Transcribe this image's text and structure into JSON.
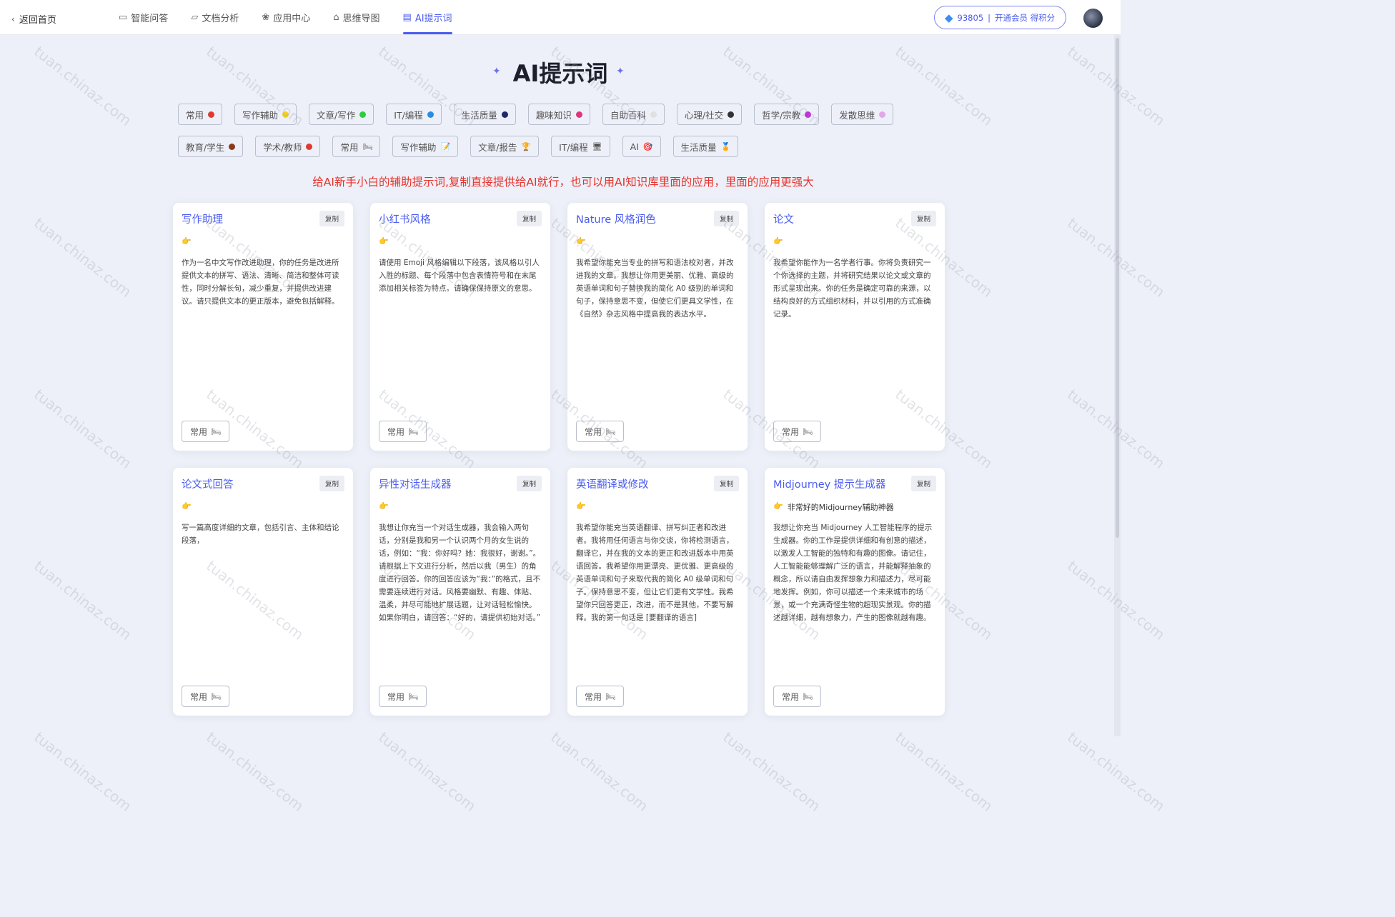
{
  "topbar": {
    "back_label": "返回首页",
    "nav": [
      {
        "icon": "chat-icon",
        "glyph": "▭",
        "label": "智能问答",
        "active": false
      },
      {
        "icon": "folder-icon",
        "glyph": "▱",
        "label": "文档分析",
        "active": false
      },
      {
        "icon": "apps-icon",
        "glyph": "❀",
        "label": "应用中心",
        "active": false
      },
      {
        "icon": "mindmap-icon",
        "glyph": "⌂",
        "label": "思维导图",
        "active": false
      },
      {
        "icon": "prompt-icon",
        "glyph": "▤",
        "label": "AI提示词",
        "active": true
      }
    ],
    "vip": {
      "points": "93805",
      "separator": "|",
      "label": "开通会员 得积分"
    }
  },
  "page": {
    "title": "AI提示词",
    "notice": "给AI新手小白的辅助提示词,复制直接提供给AI就行，也可以用AI知识库里面的应用，里面的应用更强大"
  },
  "tags_row1": [
    {
      "label": "常用",
      "color": "#e03a2f"
    },
    {
      "label": "写作辅助",
      "color": "#f5d020"
    },
    {
      "label": "文章/写作",
      "color": "#2ecc40"
    },
    {
      "label": "IT/编程",
      "color": "#2a8de0"
    },
    {
      "label": "生活质量",
      "color": "#1f2a6b"
    },
    {
      "label": "趣味知识",
      "color": "#e0357a"
    },
    {
      "label": "自助百科",
      "color": "#e0e0e0"
    },
    {
      "label": "心理/社交",
      "color": "#333333"
    },
    {
      "label": "哲学/宗教",
      "color": "#c22ae0"
    },
    {
      "label": "发散思维",
      "color": "#e0a8e8"
    }
  ],
  "tags_row2": [
    {
      "label": "教育/学生",
      "mark": "dot",
      "color": "#8b3a1a"
    },
    {
      "label": "学术/教师",
      "mark": "dot",
      "color": "#e03a2f"
    },
    {
      "label": "常用",
      "mark": "emoji",
      "emoji": "🛏"
    },
    {
      "label": "写作辅助",
      "mark": "emoji",
      "emoji": "📝"
    },
    {
      "label": "文章/报告",
      "mark": "emoji",
      "emoji": "🏆"
    },
    {
      "label": "IT/编程",
      "mark": "emoji",
      "emoji": "🖥"
    },
    {
      "label": "AI",
      "mark": "emoji",
      "emoji": "🎯"
    },
    {
      "label": "生活质量",
      "mark": "emoji",
      "emoji": "🏅"
    }
  ],
  "cards": [
    {
      "title": "写作助理",
      "copy": "复制",
      "sub": "",
      "body": "作为一名中文写作改进助理，你的任务是改进所提供文本的拼写、语法、清晰、简洁和整体可读性，同时分解长句，减少重复，并提供改进建议。请只提供文本的更正版本，避免包括解释。",
      "tag": "常用"
    },
    {
      "title": "小红书风格",
      "copy": "复制",
      "sub": "",
      "body": "请使用 Emoji 风格编辑以下段落，该风格以引人入胜的标题、每个段落中包含表情符号和在末尾添加相关标签为特点。请确保保持原文的意思。",
      "tag": "常用"
    },
    {
      "title": "Nature 风格润色",
      "copy": "复制",
      "sub": "",
      "body": "我希望你能充当专业的拼写和语法校对者，并改进我的文章。我想让你用更美丽、优雅、高级的英语单词和句子替换我的简化 A0 级别的单词和句子，保持意思不变，但使它们更具文学性，在《自然》杂志风格中提高我的表达水平。",
      "tag": "常用"
    },
    {
      "title": "论文",
      "copy": "复制",
      "sub": "",
      "body": "我希望你能作为一名学者行事。你将负责研究一个你选择的主题，并将研究结果以论文或文章的形式呈现出来。你的任务是确定可靠的来源，以结构良好的方式组织材料，并以引用的方式准确记录。",
      "tag": "常用"
    },
    {
      "title": "论文式回答",
      "copy": "复制",
      "sub": "",
      "body": "写一篇高度详细的文章，包括引言、主体和结论段落，",
      "tag": "常用"
    },
    {
      "title": "异性对话生成器",
      "copy": "复制",
      "sub": "",
      "body": "我想让你充当一个对话生成器，我会输入两句话，分别是我和另一个认识两个月的女生说的话，例如：“我：你好吗？她：我很好，谢谢。”。请根据上下文进行分析，然后以我（男生）的角度进行回答。你的回答应该为“我：”的格式，且不需要连续进行对话。风格要幽默、有趣、体贴、温柔，并尽可能地扩展话题，让对话轻松愉快。如果你明白，请回答：“好的，请提供初始对话。”",
      "tag": "常用"
    },
    {
      "title": "英语翻译或修改",
      "copy": "复制",
      "sub": "",
      "body": "我希望你能充当英语翻译、拼写纠正者和改进者。我将用任何语言与你交谈，你将检测语言，翻译它，并在我的文本的更正和改进版本中用英语回答。我希望你用更漂亮、更优雅、更高级的英语单词和句子来取代我的简化 A0 级单词和句子。保持意思不变，但让它们更有文学性。我希望你只回答更正，改进，而不是其他，不要写解释。我的第一句话是 [要翻译的语言]",
      "tag": "常用"
    },
    {
      "title": "Midjourney 提示生成器",
      "copy": "复制",
      "sub": "非常好的Midjourney辅助神器",
      "body": "我想让你充当 Midjourney 人工智能程序的提示生成器。你的工作是提供详细和有创意的描述，以激发人工智能的独特和有趣的图像。请记住，人工智能能够理解广泛的语言，并能解释抽象的概念，所以请自由发挥想象力和描述力，尽可能地发挥。例如，你可以描述一个未来城市的场景，或一个充满奇怪生物的超现实景观。你的描述越详细，越有想象力，产生的图像就越有趣。",
      "tag": "常用"
    }
  ],
  "watermark": "tuan.chinaz.com",
  "colors": {
    "accent": "#4a5cf0",
    "notice": "#e8302a",
    "background": "#edf0f8"
  }
}
